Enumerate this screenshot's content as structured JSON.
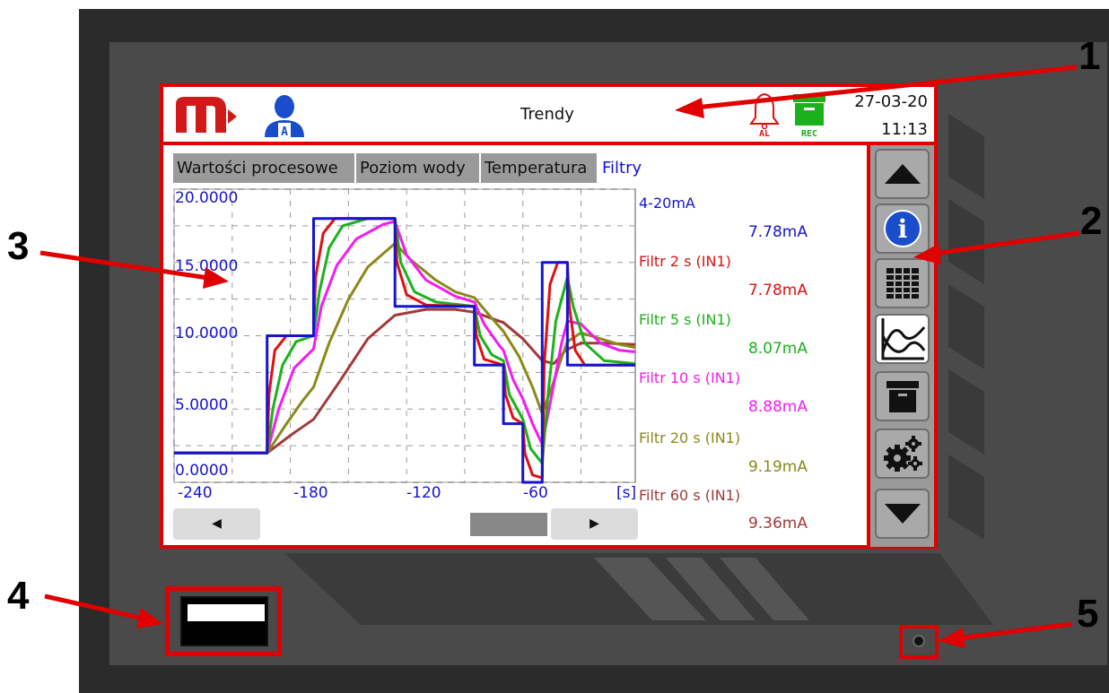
{
  "header": {
    "title": "Trendy",
    "date": "27-03-20",
    "time": "11:13",
    "alarm_label": "AL",
    "rec_label": "REC",
    "user_badge": "A"
  },
  "tabs": [
    {
      "label": "Wartości procesowe"
    },
    {
      "label": "Poziom wody"
    },
    {
      "label": "Temperatura"
    },
    {
      "label": "Filtry",
      "active": true
    }
  ],
  "legend": [
    {
      "name": "4-20mA",
      "value": "7.78",
      "unit": "mA",
      "color": "#1515d0"
    },
    {
      "name": "Filtr 2 s (IN1)",
      "value": "7.78",
      "unit": "mA",
      "color": "#e01010"
    },
    {
      "name": "Filtr 5 s (IN1)",
      "value": "8.07",
      "unit": "mA",
      "color": "#1ab21a"
    },
    {
      "name": "Filtr 10 s (IN1)",
      "value": "8.88",
      "unit": "mA",
      "color": "#f21cf2"
    },
    {
      "name": "Filtr 20 s (IN1)",
      "value": "9.19",
      "unit": "mA",
      "color": "#8a8a1a"
    },
    {
      "name": "Filtr 60 s (IN1)",
      "value": "9.36",
      "unit": "mA",
      "color": "#a03a3a"
    }
  ],
  "chart_data": {
    "type": "line",
    "x_unit_label": "[s]",
    "xlim": [
      -240,
      -2
    ],
    "ylim": [
      0,
      20
    ],
    "y_tick_labels": [
      "20.0000",
      "15.0000",
      "10.0000",
      "5.0000",
      "0.0000"
    ],
    "y_ticks": [
      20,
      15,
      10,
      5,
      0
    ],
    "x_tick_labels": [
      "-240",
      "-180",
      "-120",
      "-60"
    ],
    "x_ticks": [
      -240,
      -180,
      -120,
      -60
    ],
    "grid": true,
    "series": [
      {
        "name": "4-20mA",
        "color": "#1515d0",
        "points": [
          [
            -240,
            2
          ],
          [
            -192,
            2
          ],
          [
            -192,
            10
          ],
          [
            -168,
            10
          ],
          [
            -168,
            18
          ],
          [
            -126,
            18
          ],
          [
            -126,
            12
          ],
          [
            -85,
            12
          ],
          [
            -85,
            8
          ],
          [
            -70,
            8
          ],
          [
            -70,
            4
          ],
          [
            -60,
            4
          ],
          [
            -60,
            0
          ],
          [
            -50,
            0
          ],
          [
            -50,
            15
          ],
          [
            -37,
            15
          ],
          [
            -37,
            8
          ],
          [
            -2,
            8
          ]
        ]
      },
      {
        "name": "Filtr 2 s (IN1)",
        "color": "#e01010",
        "points": [
          [
            -240,
            2
          ],
          [
            -192,
            2
          ],
          [
            -191,
            6
          ],
          [
            -188,
            9
          ],
          [
            -182,
            10
          ],
          [
            -168,
            10
          ],
          [
            -167,
            14
          ],
          [
            -163,
            17
          ],
          [
            -157,
            18
          ],
          [
            -126,
            18
          ],
          [
            -125,
            15
          ],
          [
            -120,
            12.8
          ],
          [
            -110,
            12.1
          ],
          [
            -85,
            12
          ],
          [
            -84,
            10
          ],
          [
            -80,
            8.4
          ],
          [
            -70,
            8
          ],
          [
            -69,
            6
          ],
          [
            -65,
            4.4
          ],
          [
            -60,
            4
          ],
          [
            -59,
            2
          ],
          [
            -55,
            0.5
          ],
          [
            -50,
            0.3
          ],
          [
            -49,
            8
          ],
          [
            -46,
            13.5
          ],
          [
            -42,
            15
          ],
          [
            -37,
            15
          ],
          [
            -36,
            12
          ],
          [
            -33,
            9
          ],
          [
            -28,
            8
          ],
          [
            -2,
            8
          ]
        ]
      },
      {
        "name": "Filtr 5 s (IN1)",
        "color": "#1ab21a",
        "points": [
          [
            -240,
            2
          ],
          [
            -192,
            2
          ],
          [
            -189,
            5
          ],
          [
            -184,
            8
          ],
          [
            -177,
            9.6
          ],
          [
            -168,
            10
          ],
          [
            -165,
            13
          ],
          [
            -160,
            16
          ],
          [
            -153,
            17.5
          ],
          [
            -140,
            18
          ],
          [
            -126,
            18
          ],
          [
            -123,
            15
          ],
          [
            -116,
            13
          ],
          [
            -105,
            12.3
          ],
          [
            -85,
            12
          ],
          [
            -82,
            10
          ],
          [
            -76,
            8.7
          ],
          [
            -70,
            8.3
          ],
          [
            -67,
            6
          ],
          [
            -62,
            4.8
          ],
          [
            -60,
            4.3
          ],
          [
            -56,
            2.3
          ],
          [
            -50,
            1.3
          ],
          [
            -47,
            6
          ],
          [
            -43,
            11
          ],
          [
            -37,
            14
          ],
          [
            -34,
            12
          ],
          [
            -28,
            9.5
          ],
          [
            -18,
            8.3
          ],
          [
            -2,
            8.1
          ]
        ]
      },
      {
        "name": "Filtr 10 s (IN1)",
        "color": "#f21cf2",
        "points": [
          [
            -240,
            2
          ],
          [
            -192,
            2
          ],
          [
            -186,
            5
          ],
          [
            -178,
            7.8
          ],
          [
            -168,
            9.1
          ],
          [
            -164,
            12
          ],
          [
            -156,
            14.8
          ],
          [
            -146,
            16.6
          ],
          [
            -132,
            17.6
          ],
          [
            -126,
            17.8
          ],
          [
            -120,
            15.5
          ],
          [
            -110,
            13.8
          ],
          [
            -95,
            12.7
          ],
          [
            -85,
            12.3
          ],
          [
            -80,
            10.8
          ],
          [
            -72,
            9.3
          ],
          [
            -70,
            9
          ],
          [
            -65,
            7
          ],
          [
            -60,
            5.7
          ],
          [
            -55,
            4
          ],
          [
            -50,
            2.6
          ],
          [
            -45,
            6
          ],
          [
            -40,
            9.5
          ],
          [
            -37,
            11
          ],
          [
            -30,
            10.8
          ],
          [
            -20,
            9.5
          ],
          [
            -10,
            9
          ],
          [
            -2,
            8.9
          ]
        ]
      },
      {
        "name": "Filtr 20 s (IN1)",
        "color": "#8a8a1a",
        "points": [
          [
            -240,
            2
          ],
          [
            -192,
            2
          ],
          [
            -183,
            3.8
          ],
          [
            -174,
            5.5
          ],
          [
            -168,
            6.5
          ],
          [
            -160,
            9.5
          ],
          [
            -150,
            12.5
          ],
          [
            -140,
            14.7
          ],
          [
            -126,
            16.3
          ],
          [
            -118,
            15.2
          ],
          [
            -105,
            13.8
          ],
          [
            -95,
            13
          ],
          [
            -85,
            12.6
          ],
          [
            -78,
            11.5
          ],
          [
            -70,
            10.3
          ],
          [
            -62,
            8.6
          ],
          [
            -55,
            6.5
          ],
          [
            -50,
            4.7
          ],
          [
            -45,
            6.5
          ],
          [
            -40,
            8.5
          ],
          [
            -37,
            9.6
          ],
          [
            -30,
            10.2
          ],
          [
            -20,
            9.8
          ],
          [
            -10,
            9.4
          ],
          [
            -2,
            9.2
          ]
        ]
      },
      {
        "name": "Filtr 60 s (IN1)",
        "color": "#a03a3a",
        "points": [
          [
            -240,
            2
          ],
          [
            -192,
            2
          ],
          [
            -180,
            3.2
          ],
          [
            -168,
            4.3
          ],
          [
            -155,
            6.8
          ],
          [
            -140,
            9.8
          ],
          [
            -126,
            11.4
          ],
          [
            -110,
            11.8
          ],
          [
            -95,
            11.8
          ],
          [
            -85,
            11.6
          ],
          [
            -70,
            10.9
          ],
          [
            -60,
            9.8
          ],
          [
            -50,
            8.3
          ],
          [
            -44,
            8.1
          ],
          [
            -38,
            9
          ],
          [
            -30,
            9.5
          ],
          [
            -18,
            9.5
          ],
          [
            -2,
            9.4
          ]
        ]
      }
    ]
  },
  "toolbar": {
    "info_glyph": "i"
  },
  "callouts": [
    "1",
    "2",
    "3",
    "4",
    "5"
  ],
  "colors": {
    "frame_dark": "#2b2b2b",
    "frame_mid": "#4a4a4a",
    "highlight_red": "#e10000",
    "brand_red": "#d01a1a",
    "user_blue": "#1a4dcc"
  }
}
